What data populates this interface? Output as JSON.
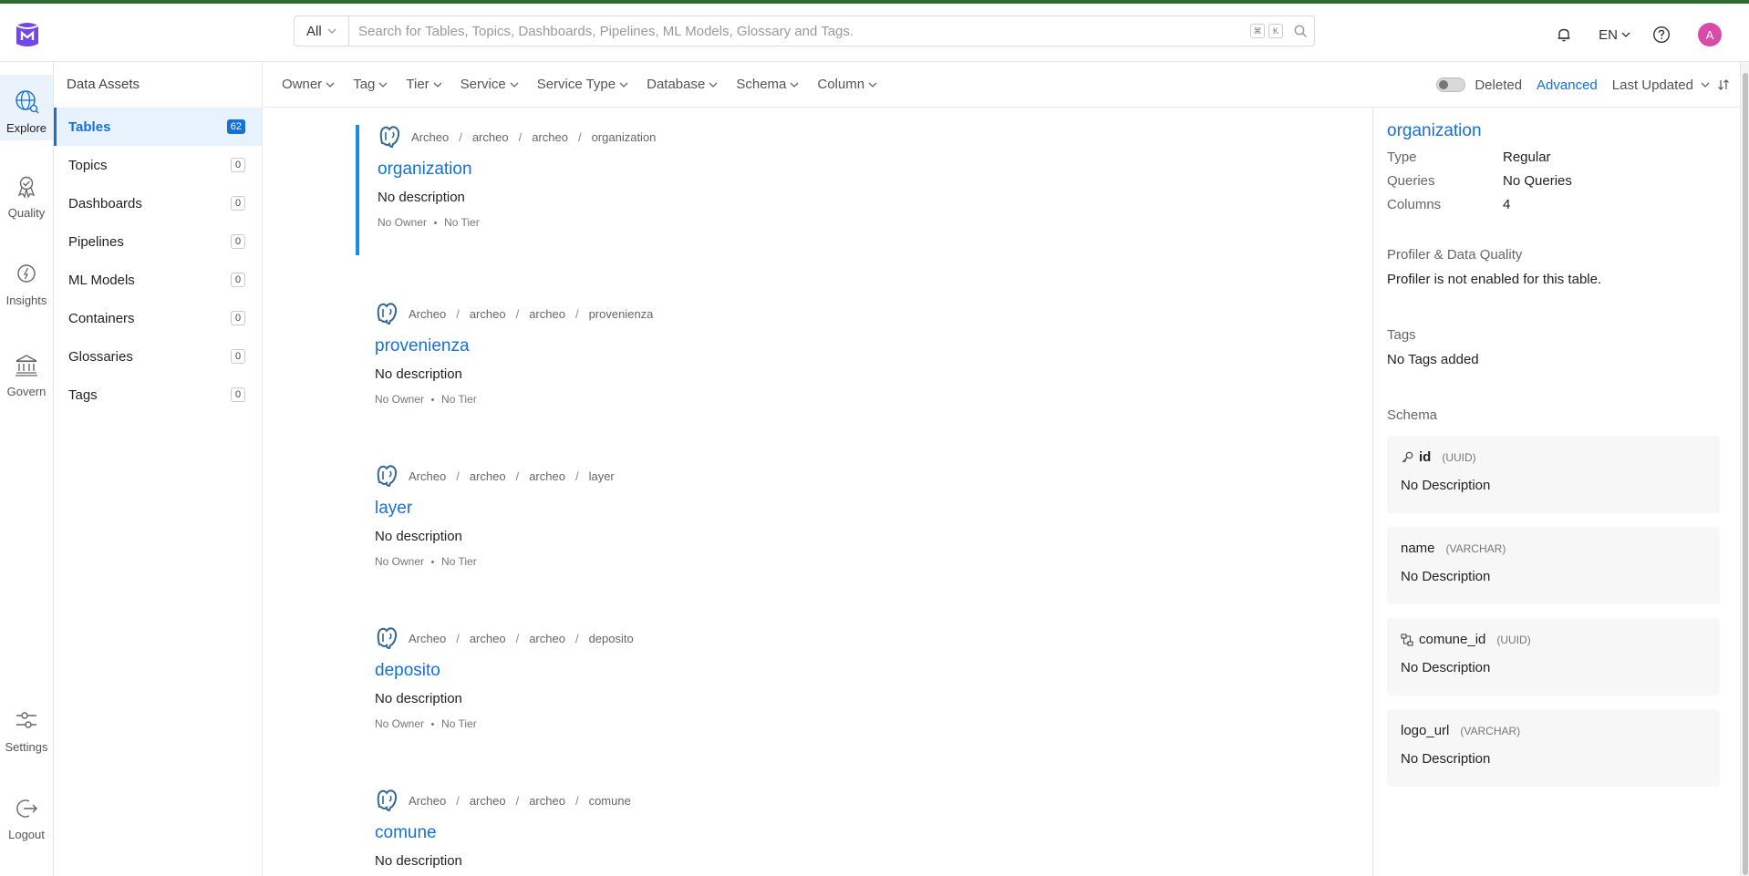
{
  "search": {
    "category": "All",
    "placeholder": "Search for Tables, Topics, Dashboards, Pipelines, ML Models, Glossary and Tags.",
    "kbd1": "⌘",
    "kbd2": "K"
  },
  "header": {
    "language": "EN",
    "avatar_initial": "A"
  },
  "leftnav": {
    "explore": "Explore",
    "quality": "Quality",
    "insights": "Insights",
    "govern": "Govern",
    "settings": "Settings",
    "logout": "Logout"
  },
  "assets": {
    "title": "Data Assets",
    "items": [
      {
        "label": "Tables",
        "count": "62"
      },
      {
        "label": "Topics",
        "count": "0"
      },
      {
        "label": "Dashboards",
        "count": "0"
      },
      {
        "label": "Pipelines",
        "count": "0"
      },
      {
        "label": "ML Models",
        "count": "0"
      },
      {
        "label": "Containers",
        "count": "0"
      },
      {
        "label": "Glossaries",
        "count": "0"
      },
      {
        "label": "Tags",
        "count": "0"
      }
    ]
  },
  "filters": {
    "items": [
      "Owner",
      "Tag",
      "Tier",
      "Service",
      "Service Type",
      "Database",
      "Schema",
      "Column"
    ],
    "deleted": "Deleted",
    "advanced": "Advanced",
    "sort": "Last Updated"
  },
  "results": [
    {
      "bc": [
        "Archeo",
        "archeo",
        "archeo",
        "organization"
      ],
      "title": "organization",
      "desc": "No description",
      "owner": "No Owner",
      "tier": "No Tier"
    },
    {
      "bc": [
        "Archeo",
        "archeo",
        "archeo",
        "provenienza"
      ],
      "title": "provenienza",
      "desc": "No description",
      "owner": "No Owner",
      "tier": "No Tier"
    },
    {
      "bc": [
        "Archeo",
        "archeo",
        "archeo",
        "layer"
      ],
      "title": "layer",
      "desc": "No description",
      "owner": "No Owner",
      "tier": "No Tier"
    },
    {
      "bc": [
        "Archeo",
        "archeo",
        "archeo",
        "deposito"
      ],
      "title": "deposito",
      "desc": "No description",
      "owner": "No Owner",
      "tier": "No Tier"
    },
    {
      "bc": [
        "Archeo",
        "archeo",
        "archeo",
        "comune"
      ],
      "title": "comune",
      "desc": "No description",
      "owner": "No Owner",
      "tier": "No Tier"
    }
  ],
  "panel": {
    "title": "organization",
    "type_label": "Type",
    "type_value": "Regular",
    "queries_label": "Queries",
    "queries_value": "No Queries",
    "columns_label": "Columns",
    "columns_value": "4",
    "profiler_label": "Profiler & Data Quality",
    "profiler_value": "Profiler is not enabled for this table.",
    "tags_label": "Tags",
    "tags_value": "No Tags added",
    "schema_label": "Schema",
    "columns": [
      {
        "name": "id",
        "type": "(UUID)",
        "desc": "No Description",
        "icon": "key-icon"
      },
      {
        "name": "name",
        "type": "(VARCHAR)",
        "desc": "No Description",
        "icon": ""
      },
      {
        "name": "comune_id",
        "type": "(UUID)",
        "desc": "No Description",
        "icon": "foreign-key-icon"
      },
      {
        "name": "logo_url",
        "type": "(VARCHAR)",
        "desc": "No Description",
        "icon": ""
      }
    ]
  }
}
